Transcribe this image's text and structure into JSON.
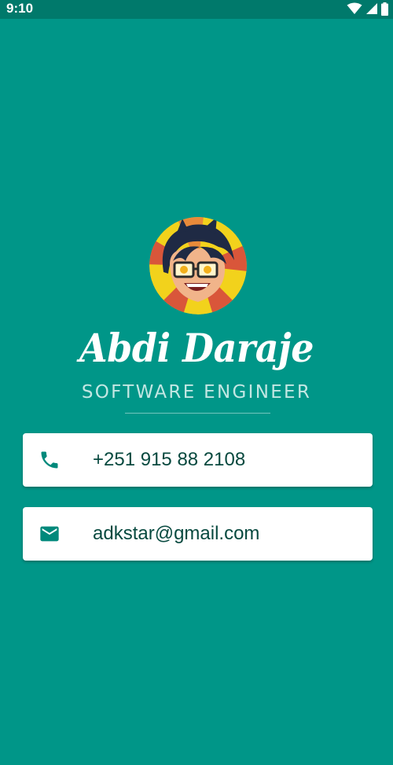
{
  "status_bar": {
    "time": "9:10",
    "icons": [
      "wifi-icon",
      "signal-icon",
      "battery-icon"
    ]
  },
  "profile": {
    "name": "Abdi Daraje",
    "title": "SOFTWARE ENGINEER",
    "avatar_icon": "cartoon-avatar"
  },
  "contacts": [
    {
      "icon": "phone-icon",
      "value": "+251 915 88 2108"
    },
    {
      "icon": "email-icon",
      "value": "adkstar@gmail.com"
    }
  ],
  "colors": {
    "background": "#009688",
    "status_bar": "#00796b",
    "card": "#ffffff",
    "card_text": "#07493f",
    "icon": "#00897b",
    "title_text": "#c3e7e3"
  }
}
